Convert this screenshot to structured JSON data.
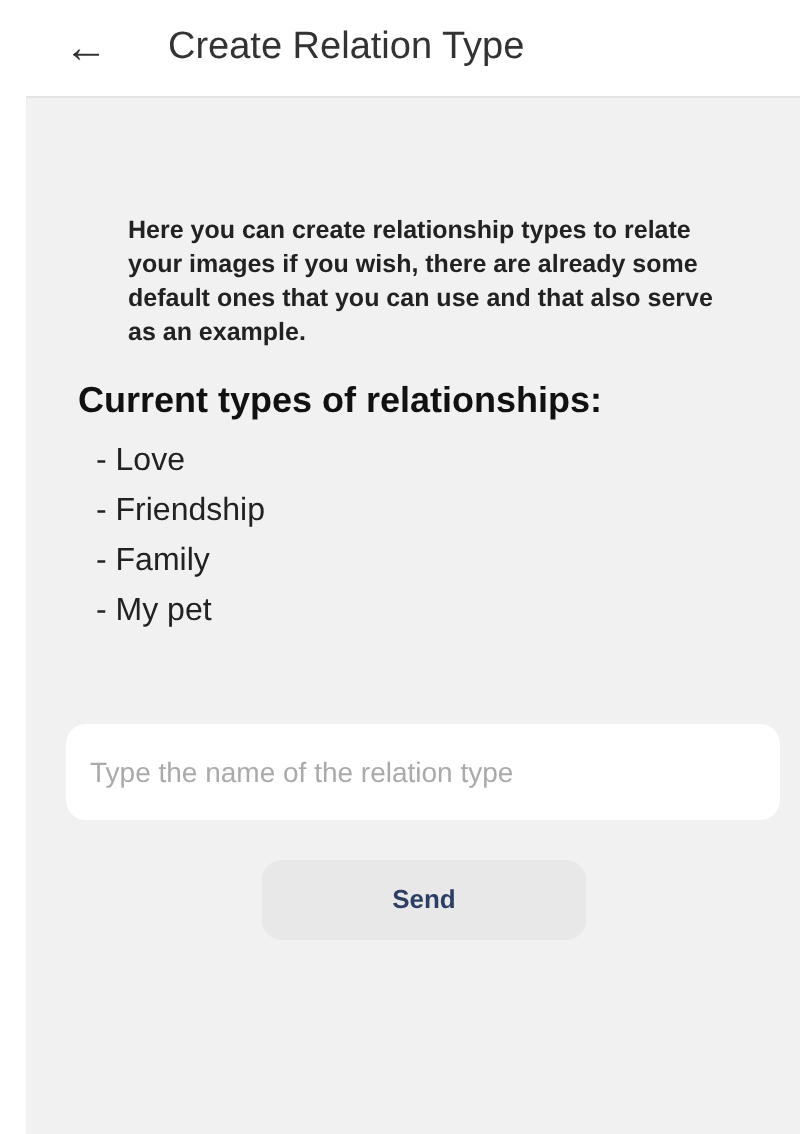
{
  "app_bar": {
    "back": "←",
    "title": "Create Relation Type"
  },
  "intro": "Here you can create relationship types to relate your images if you wish, there are already some default ones that you can use and that also serve as an example.",
  "heading": "Current types of relationships:",
  "types": [
    "- Love",
    "- Friendship",
    "- Family",
    "- My pet"
  ],
  "name_field": {
    "placeholder": "Type the name of the relation type"
  },
  "send_button": "Send"
}
